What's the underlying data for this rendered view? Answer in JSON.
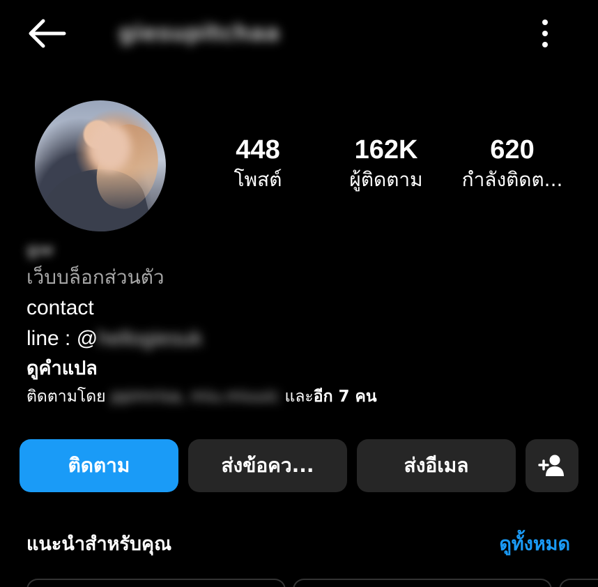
{
  "header": {
    "username": "giesupitchaa",
    "back_icon": "arrow-left-icon",
    "menu_icon": "more-vertical-icon"
  },
  "profile": {
    "avatar_icon": "profile-photo",
    "stats": [
      {
        "value": "448",
        "label": "โพสต์"
      },
      {
        "value": "162K",
        "label": "ผู้ติดตาม"
      },
      {
        "value": "620",
        "label": "กำลังติดต..."
      }
    ]
  },
  "bio": {
    "display_name": "gw",
    "category": "เว็บบล็อกส่วนตัว",
    "line1": "contact",
    "line2_prefix": "line : @",
    "line2_handle": "hellogiesuk",
    "translate": "ดูคำแปล",
    "followed_prefix": "ติดตามโดย ",
    "followed_names": "ppimrisa, miu.miuuic",
    "followed_mid": " และ",
    "followed_count": "อีก 7 คน"
  },
  "actions": {
    "follow": "ติดตาม",
    "message": "ส่งข้อคว...",
    "email": "ส่งอีเมล",
    "suggest_icon": "add-person-icon"
  },
  "suggestions": {
    "title": "แนะนำสำหรับคุณ",
    "see_all": "ดูทั้งหมด"
  },
  "colors": {
    "background": "#000000",
    "accent": "#1a9bf7",
    "button": "#262626",
    "secondary_text": "#a8a8a8"
  }
}
